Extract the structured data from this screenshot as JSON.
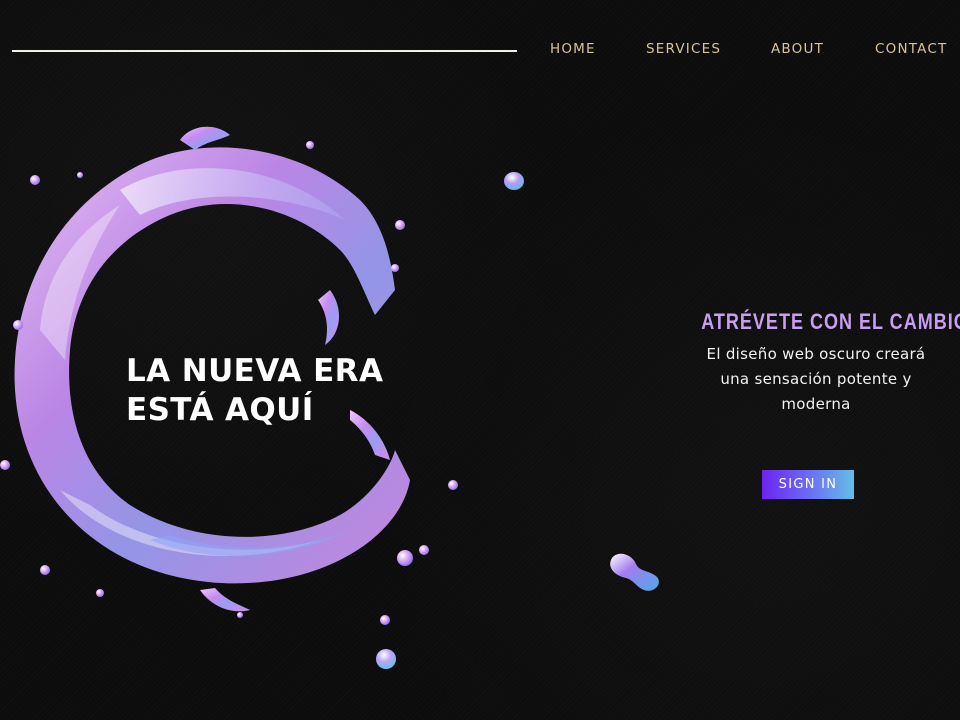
{
  "nav": {
    "items": [
      {
        "label": "HOME"
      },
      {
        "label": "SERVICES"
      },
      {
        "label": "ABOUT"
      },
      {
        "label": "CONTACT"
      }
    ]
  },
  "hero": {
    "title_line1": "LA NUEVA ERA",
    "title_line2": "ESTÁ AQUÍ"
  },
  "side": {
    "subtitle": "ATRÉVETE CON EL CAMBIO",
    "description": "El diseño web oscuro creará una sensación potente y moderna",
    "signin_label": "SIGN IN"
  },
  "colors": {
    "background": "#0b0b0b",
    "nav_text": "#d8c39a",
    "accent_purple": "#c89ff0",
    "button_gradient_start": "#6c24f0",
    "button_gradient_end": "#64bde8"
  }
}
